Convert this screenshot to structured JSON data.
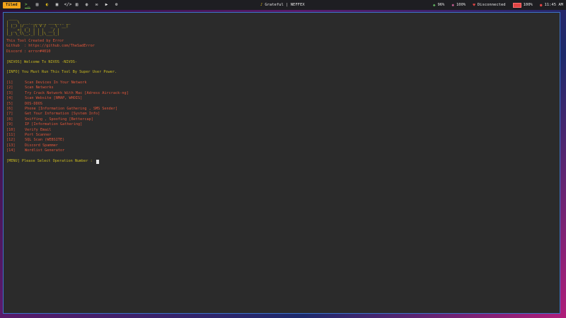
{
  "panel": {
    "workspace": "Tiled",
    "now_playing": "Grateful | NEFFEX",
    "status": [
      {
        "icon": "wifi-icon",
        "value": "96%"
      },
      {
        "icon": "cpu-icon",
        "value": "100%"
      },
      {
        "icon": "vpn-icon",
        "value": "Disconnected"
      },
      {
        "icon": "battery-icon",
        "value": "100%"
      },
      {
        "icon": "clock-icon",
        "value": "11:45 AM"
      }
    ]
  },
  "terminal": {
    "ascii_art": " ____\n|  _ \\  __ _ __ __ _____ _ __\n| |_) |/ _` |\\ V /  _ \\ '__|\n|  _ <| (_| | | |  __/ |\n|_| \\_\\\\__,_| |_|\\___|_|",
    "credits": [
      "This Tool Created by Error",
      "Github  : https://github.com/TheSadError",
      "Discord : error#4010"
    ],
    "welcome": "[NIVOS] Welcome To NIVOS -NIVOS-",
    "info": "[INFO] You Must Run This Tool By Super User Power.",
    "menu": [
      {
        "num": "[1]",
        "text": "Scan Devices In Your Network"
      },
      {
        "num": "[2]",
        "text": "Scan Networks"
      },
      {
        "num": "[3]",
        "text": "Try Crack Network With Mac [Adress Aircrack-ng]"
      },
      {
        "num": "[4]",
        "text": "Scan Website [NMAP, WHOIS]"
      },
      {
        "num": "[5]",
        "text": "DOS-DDOS"
      },
      {
        "num": "[6]",
        "text": "Phone [Information Gathering , SMS Sender]"
      },
      {
        "num": "[7]",
        "text": "Get Your Information [System Info]"
      },
      {
        "num": "[8]",
        "text": "Sniffing , Spoofing [Bettercap]"
      },
      {
        "num": "[9]",
        "text": "IP [Information Gathering]"
      },
      {
        "num": "[10]",
        "text": "Verify Email"
      },
      {
        "num": "[11]",
        "text": "Port Scanner"
      },
      {
        "num": "[12]",
        "text": "SQL Scan (WEBSITE)"
      },
      {
        "num": "[13]",
        "text": "Discord Spammer"
      },
      {
        "num": "[14]",
        "text": "Wordlist Generator"
      }
    ],
    "prompt": "[MENU] Please Select Operation Number : "
  },
  "colors": {
    "accent_workspace": "#f2a51a",
    "terminal_border": "#3d73c9",
    "terminal_bg": "#2b2b2b",
    "menu_text": "#e0553a",
    "header_text": "#c8b820"
  }
}
